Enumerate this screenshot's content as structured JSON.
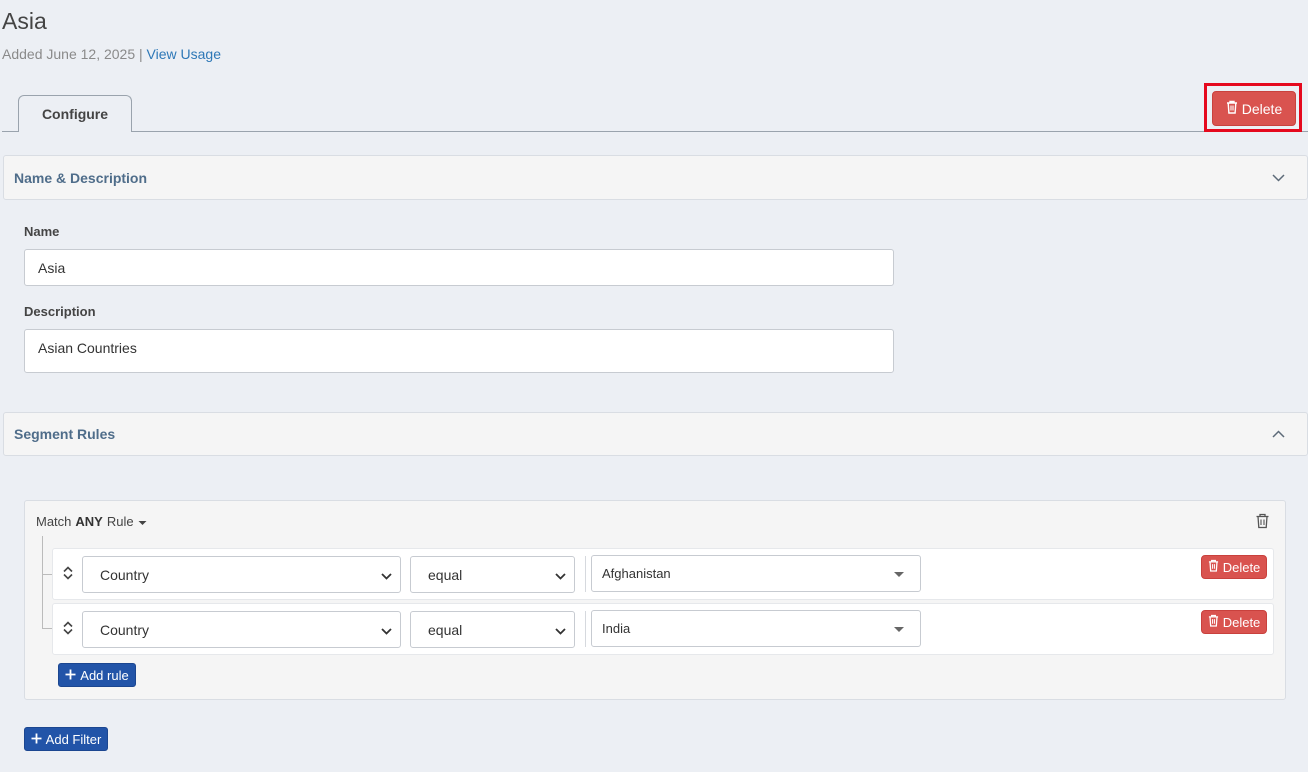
{
  "header": {
    "title": "Asia",
    "added_text": "Added June 12, 2025",
    "separator": "|",
    "view_usage": "View Usage"
  },
  "tabs": [
    {
      "label": "Configure"
    }
  ],
  "actions": {
    "delete_label": "Delete"
  },
  "sections": {
    "name_description": {
      "title": "Name & Description",
      "name_label": "Name",
      "name_value": "Asia",
      "description_label": "Description",
      "description_value": "Asian Countries"
    },
    "segment_rules": {
      "title": "Segment Rules"
    }
  },
  "rules_group": {
    "match_prefix": "Match",
    "match_mode": "ANY",
    "match_suffix": "Rule",
    "rules": [
      {
        "field": "Country",
        "operator": "equal",
        "value": "Afghanistan",
        "delete_label": "Delete"
      },
      {
        "field": "Country",
        "operator": "equal",
        "value": "India",
        "delete_label": "Delete"
      }
    ],
    "add_rule_label": "Add rule"
  },
  "add_filter_label": "Add Filter",
  "colors": {
    "danger": "#d9534f",
    "primary": "#2254a8",
    "highlight": "#e5091d",
    "link": "#2e78b7"
  }
}
